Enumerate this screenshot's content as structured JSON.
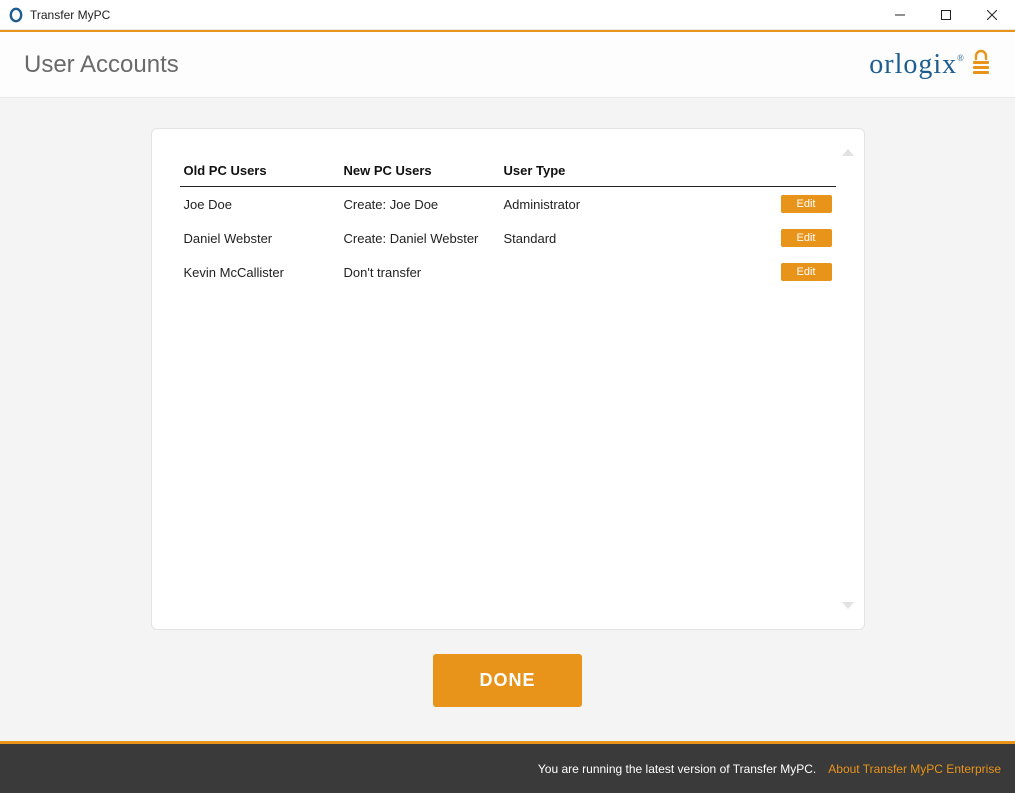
{
  "window": {
    "title": "Transfer MyPC"
  },
  "header": {
    "title": "User Accounts",
    "brand": "orlogix"
  },
  "table": {
    "headers": {
      "old": "Old PC Users",
      "new": "New PC Users",
      "type": "User Type"
    },
    "rows": [
      {
        "old": "Joe Doe",
        "new": "Create: Joe Doe",
        "type": "Administrator",
        "action": "Edit"
      },
      {
        "old": "Daniel Webster",
        "new": "Create: Daniel Webster",
        "type": "Standard",
        "action": "Edit"
      },
      {
        "old": "Kevin McCallister",
        "new": "Don't transfer",
        "type": "",
        "action": "Edit"
      }
    ]
  },
  "buttons": {
    "done": "DONE"
  },
  "footer": {
    "status": "You are running the latest version of Transfer MyPC.",
    "link": "About Transfer MyPC Enterprise"
  }
}
